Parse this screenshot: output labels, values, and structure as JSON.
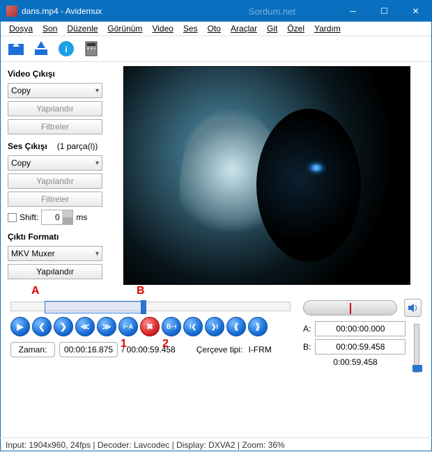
{
  "window": {
    "title": "dans.mp4 - Avidemux",
    "watermark": "Sordum.net"
  },
  "menu": {
    "items": [
      "Dosya",
      "Son",
      "Düzenle",
      "Görünüm",
      "Video",
      "Ses",
      "Oto",
      "Araçlar",
      "Git",
      "Özel",
      "Yardım"
    ]
  },
  "video_output": {
    "title": "Video Çıkışı",
    "codec": "Copy",
    "configure": "Yapılandır",
    "filters": "Filtreler"
  },
  "audio_output": {
    "title": "Ses Çıkışı",
    "tracks": "(1 parça(l))",
    "codec": "Copy",
    "configure": "Yapılandır",
    "filters": "Filtreler",
    "shift_label": "Shift:",
    "shift_value": "0",
    "shift_unit": "ms"
  },
  "output_format": {
    "title": "Çıktı Formatı",
    "muxer": "MKV Muxer",
    "configure": "Yapılandır"
  },
  "annotations": {
    "A": "A",
    "B": "B",
    "one": "1",
    "two": "2"
  },
  "marks": {
    "a_label": "A:",
    "a_value": "00:00:00.000",
    "b_label": "B:",
    "b_value": "00:00:59.458",
    "selection_dur": "0:00:59.458"
  },
  "time": {
    "label": "Zaman:",
    "current": "00:00:16.875",
    "total": "/ 00:00:59.458",
    "frame_type_label": "Çerçeve tipi:",
    "frame_type": "I-FRM"
  },
  "status": {
    "text": "Input: 1904x960, 24fps  |  Decoder: Lavcodec  |  Display: DXVA2  |  Zoom: 36%"
  }
}
